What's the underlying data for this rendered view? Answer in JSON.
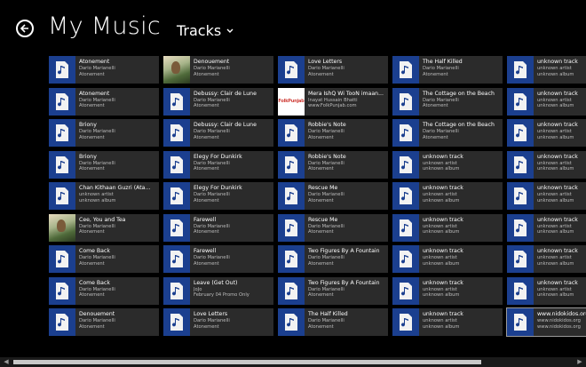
{
  "header": {
    "title": "My Music",
    "view_label": "Tracks"
  },
  "tracks": [
    [
      {
        "title": "Atonement",
        "artist": "Dario Marianelli",
        "album": "Atonement",
        "thumb": "note"
      },
      {
        "title": "Atonement",
        "artist": "Dario Marianelli",
        "album": "Atonement",
        "thumb": "note"
      },
      {
        "title": "Briony",
        "artist": "Dario Marianelli",
        "album": "Atonement",
        "thumb": "note"
      },
      {
        "title": "Briony",
        "artist": "Dario Marianelli",
        "album": "Atonement",
        "thumb": "note"
      },
      {
        "title": "Chan Kithaan Guzri (Ata...",
        "artist": "unknown artist",
        "album": "unknown album",
        "thumb": "note"
      },
      {
        "title": "Cee, You and Tea",
        "artist": "Dario Marianelli",
        "album": "Atonement",
        "thumb": "art"
      },
      {
        "title": "Come Back",
        "artist": "Dario Marianelli",
        "album": "Atonement",
        "thumb": "note"
      },
      {
        "title": "Come Back",
        "artist": "Dario Marianelli",
        "album": "Atonement",
        "thumb": "note"
      },
      {
        "title": "Denouement",
        "artist": "Dario Marianelli",
        "album": "Atonement",
        "thumb": "note"
      }
    ],
    [
      {
        "title": "Denouement",
        "artist": "Dario Marianelli",
        "album": "Atonement",
        "thumb": "art"
      },
      {
        "title": "Debussy: Clair de Lune",
        "artist": "Dario Marianelli",
        "album": "Atonement",
        "thumb": "note"
      },
      {
        "title": "Debussy: Clair de Lune",
        "artist": "Dario Marianelli",
        "album": "Atonement",
        "thumb": "note"
      },
      {
        "title": "Elegy For Dunkirk",
        "artist": "Dario Marianelli",
        "album": "Atonement",
        "thumb": "note"
      },
      {
        "title": "Elegy For Dunkirk",
        "artist": "Dario Marianelli",
        "album": "Atonement",
        "thumb": "note"
      },
      {
        "title": "Farewell",
        "artist": "Dario Marianelli",
        "album": "Atonement",
        "thumb": "note"
      },
      {
        "title": "Farewell",
        "artist": "Dario Marianelli",
        "album": "Atonement",
        "thumb": "note"
      },
      {
        "title": "Leave (Get Out)",
        "artist": "JoJo",
        "album": "February 04 Promo Only",
        "thumb": "note"
      },
      {
        "title": "Love Letters",
        "artist": "Dario Marianelli",
        "album": "Atonement",
        "thumb": "note"
      }
    ],
    [
      {
        "title": "Love Letters",
        "artist": "Dario Marianelli",
        "album": "Atonement",
        "thumb": "note"
      },
      {
        "title": "Mera IshQ Wi TooN imaan...",
        "artist": "Inayat Hussain Bhatti",
        "album": "www.FolkPunjab.com",
        "thumb": "white"
      },
      {
        "title": "Robbie's Note",
        "artist": "Dario Marianelli",
        "album": "Atonement",
        "thumb": "note"
      },
      {
        "title": "Robbie's Note",
        "artist": "Dario Marianelli",
        "album": "Atonement",
        "thumb": "note"
      },
      {
        "title": "Rescue Me",
        "artist": "Dario Marianelli",
        "album": "Atonement",
        "thumb": "note"
      },
      {
        "title": "Rescue Me",
        "artist": "Dario Marianelli",
        "album": "Atonement",
        "thumb": "note"
      },
      {
        "title": "Two Figures By A Fountain",
        "artist": "Dario Marianelli",
        "album": "Atonement",
        "thumb": "note"
      },
      {
        "title": "Two Figures By A Fountain",
        "artist": "Dario Marianelli",
        "album": "Atonement",
        "thumb": "note"
      },
      {
        "title": "The Half Killed",
        "artist": "Dario Marianelli",
        "album": "Atonement",
        "thumb": "note"
      }
    ],
    [
      {
        "title": "The Half Killed",
        "artist": "Dario Marianelli",
        "album": "Atonement",
        "thumb": "note"
      },
      {
        "title": "The Cottage on the Beach",
        "artist": "Dario Marianelli",
        "album": "Atonement",
        "thumb": "note"
      },
      {
        "title": "The Cottage on the Beach",
        "artist": "Dario Marianelli",
        "album": "Atonement",
        "thumb": "note"
      },
      {
        "title": "unknown track",
        "artist": "unknown artist",
        "album": "unknown album",
        "thumb": "note"
      },
      {
        "title": "unknown track",
        "artist": "unknown artist",
        "album": "unknown album",
        "thumb": "note"
      },
      {
        "title": "unknown track",
        "artist": "unknown artist",
        "album": "unknown album",
        "thumb": "note"
      },
      {
        "title": "unknown track",
        "artist": "unknown artist",
        "album": "unknown album",
        "thumb": "note"
      },
      {
        "title": "unknown track",
        "artist": "unknown artist",
        "album": "unknown album",
        "thumb": "note"
      },
      {
        "title": "unknown track",
        "artist": "unknown artist",
        "album": "unknown album",
        "thumb": "note"
      }
    ],
    [
      {
        "title": "unknown track",
        "artist": "unknown artist",
        "album": "unknown album",
        "thumb": "note"
      },
      {
        "title": "unknown track",
        "artist": "unknown artist",
        "album": "unknown album",
        "thumb": "note"
      },
      {
        "title": "unknown track",
        "artist": "unknown artist",
        "album": "unknown album",
        "thumb": "note"
      },
      {
        "title": "unknown track",
        "artist": "unknown artist",
        "album": "unknown album",
        "thumb": "note"
      },
      {
        "title": "unknown track",
        "artist": "unknown artist",
        "album": "unknown album",
        "thumb": "note"
      },
      {
        "title": "unknown track",
        "artist": "unknown artist",
        "album": "unknown album",
        "thumb": "note"
      },
      {
        "title": "unknown track",
        "artist": "unknown artist",
        "album": "unknown album",
        "thumb": "note"
      },
      {
        "title": "unknown track",
        "artist": "unknown artist",
        "album": "unknown album",
        "thumb": "note"
      },
      {
        "title": "www.nidokidos.org",
        "artist": "www.nidokidos.org",
        "album": "www.nidokidos.org",
        "thumb": "note",
        "selected": true
      }
    ]
  ],
  "white_thumb_text": "FolkPunjab",
  "colors": {
    "background": "#000000",
    "tile": "#2b2b2b",
    "thumb_blue": "#1b3f8f"
  },
  "icons": {
    "back": "back-arrow-icon",
    "view_picker": "chevron-down-icon",
    "track": "music-note-icon"
  }
}
